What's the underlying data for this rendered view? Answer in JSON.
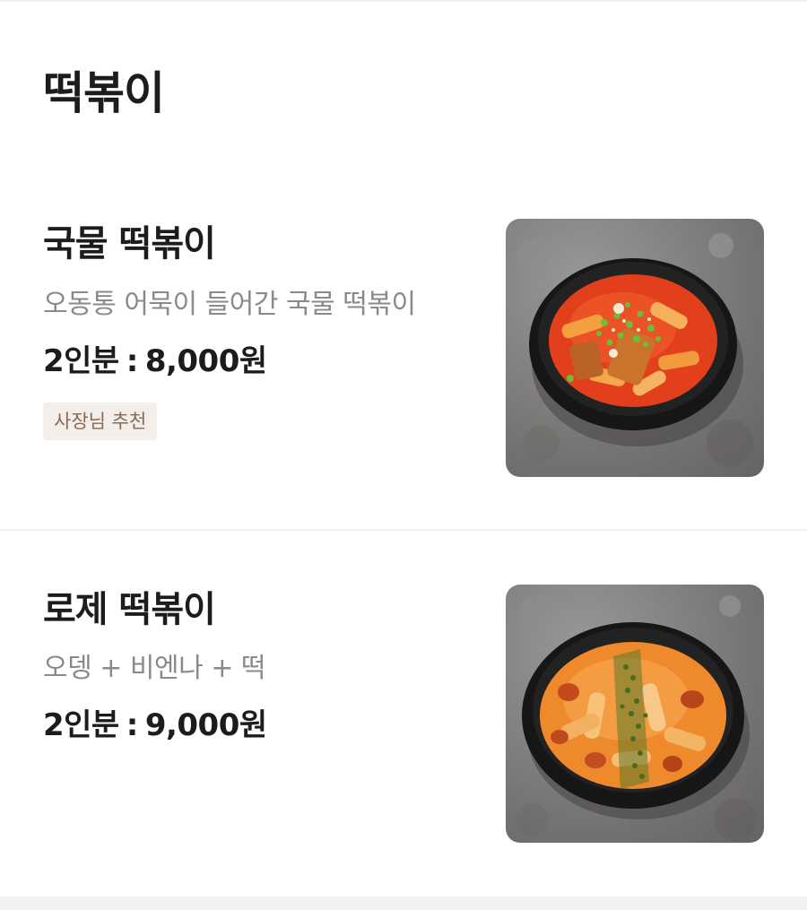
{
  "category": {
    "title": "떡볶이"
  },
  "items": [
    {
      "name": "국물 떡볶이",
      "description": "오동통 어묵이 들어간 국물 떡볶이",
      "price_label": "2인분",
      "price_value": "8,000원",
      "badge": "사장님 추천",
      "photo_icon": "guk-mul-tteokbokki-bowl-photo"
    },
    {
      "name": "로제 떡볶이",
      "description": "오뎅 + 비엔나 + 떡",
      "price_label": "2인분",
      "price_value": "9,000원",
      "photo_icon": "rose-tteokbokki-bowl-photo"
    }
  ],
  "colors": {
    "title": "#1c1c1c",
    "description": "#8a8a8a",
    "badge_bg": "#f3eee9",
    "badge_text": "#8a6a55",
    "broth_red": "#e8461f",
    "rose_orange": "#ee8a2c",
    "scallion_green": "#6bbf3a"
  }
}
